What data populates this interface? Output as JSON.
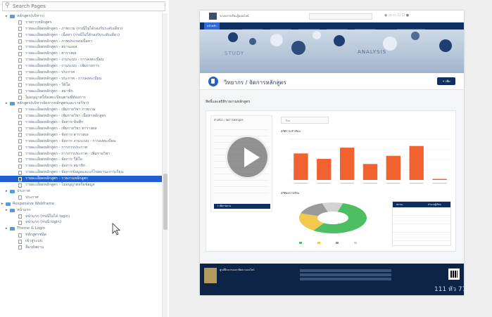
{
  "search": {
    "placeholder": "Search Pages"
  },
  "tree": [
    {
      "label": "หลักสูตร(บริหาร)",
      "level": 1,
      "type": "folder",
      "expanded": true
    },
    {
      "label": "รายการหลักสูตร",
      "level": 2,
      "type": "page"
    },
    {
      "label": "รายละเอียดหลักสูตร - ภาพรวม (กรณีไม่ได้รองรับระดับเดียว)",
      "level": 2,
      "type": "page"
    },
    {
      "label": "รายละเอียดหลักสูตร - เนื้อหา (กรณีไม่ได้รองรับระดับเดียว)",
      "level": 2,
      "type": "page"
    },
    {
      "label": "รายละเอียดหลักสูตร - ภาพประกอบเนื้อหา",
      "level": 2,
      "type": "page"
    },
    {
      "label": "รายละเอียดหลักสูตร - สถานะผล",
      "level": 2,
      "type": "page"
    },
    {
      "label": "รายละเอียดหลักสูตร - ตารางผล",
      "level": 2,
      "type": "page"
    },
    {
      "label": "รายละเอียดหลักสูตร - งานระบบ - การลงทะเบียน",
      "level": 2,
      "type": "page"
    },
    {
      "label": "รายละเอียดหลักสูตร - งานระบบ - เพิ่มรายการ",
      "level": 2,
      "type": "page"
    },
    {
      "label": "รายละเอียดหลักสูตร - ประกาศ",
      "level": 2,
      "type": "page"
    },
    {
      "label": "รายละเอียดหลักสูตร - ประกาศ - การลงทะเบียน",
      "level": 2,
      "type": "page"
    },
    {
      "label": "รายละเอียดหลักสูตร - วีดิโอ",
      "level": 2,
      "type": "page"
    },
    {
      "label": "รายละเอียดหลักสูตร - สมาชิก",
      "level": 2,
      "type": "page"
    },
    {
      "label": "ไม่อนุญาตให้ลงทะเบียนตามที่ต้องการ",
      "level": 2,
      "type": "page"
    },
    {
      "label": "หลักสูตร(บริหารจัดการหลักสูตรและรายวิชา)",
      "level": 1,
      "type": "folder",
      "expanded": true
    },
    {
      "label": "รายละเอียดหลักสูตร - เพิ่มรายวิชา ภาพรวม",
      "level": 2,
      "type": "page"
    },
    {
      "label": "รายละเอียดหลักสูตร - เพิ่มรายวิชา เนื้อหาหลักสูตร",
      "level": 2,
      "type": "page"
    },
    {
      "label": "รายละเอียดหลักสูตร - จัดการ บันทึก",
      "level": 2,
      "type": "page"
    },
    {
      "label": "รายละเอียดหลักสูตร - เพิ่มรายวิชา ตารางผล",
      "level": 2,
      "type": "page"
    },
    {
      "label": "รายละเอียดหลักสูตร - จัดการ ตารางผล",
      "level": 2,
      "type": "page"
    },
    {
      "label": "รายละเอียดหลักสูตร - จัดการ งานระบบ - การลงทะเบียน",
      "level": 2,
      "type": "page"
    },
    {
      "label": "รายละเอียดหลักสูตร - การการประกาศ",
      "level": 2,
      "type": "page"
    },
    {
      "label": "รายละเอียดหลักสูตร - การการประกาศ - เพิ่มรายวิชา",
      "level": 2,
      "type": "page"
    },
    {
      "label": "รายละเอียดหลักสูตร - จัดการ วีดิโอ",
      "level": 2,
      "type": "page"
    },
    {
      "label": "รายละเอียดหลักสูตร - จัดการ สมาชิก",
      "level": 2,
      "type": "page"
    },
    {
      "label": "รายละเอียดหลักสูตร - จัดการข้อมูลและแก้ไขสถานะการเรียน",
      "level": 2,
      "type": "page"
    },
    {
      "label": "รายละเอียดหลักสูตร - รายงานหลักสูตร",
      "level": 2,
      "type": "page",
      "selected": true
    },
    {
      "label": "รายละเอียดหลักสูตร - ไม่อนุญาตหรือข้อมูล",
      "level": 2,
      "type": "page"
    },
    {
      "label": "ประกาศ",
      "level": 1,
      "type": "folder",
      "expanded": true
    },
    {
      "label": "ประกาศ",
      "level": 2,
      "type": "page"
    },
    {
      "label": "Responsive Webframe",
      "level": 0,
      "type": "folder",
      "expanded": true
    },
    {
      "label": "หน้าแรก",
      "level": 1,
      "type": "folder",
      "expanded": true
    },
    {
      "label": "หน้าแรก (กรณีไม่ได้ login)",
      "level": 2,
      "type": "page"
    },
    {
      "label": "หน้าแรก (กรณี login)",
      "level": 2,
      "type": "page"
    },
    {
      "label": "Theme & Login",
      "level": 1,
      "type": "folder",
      "expanded": true
    },
    {
      "label": "หลักสูตรชนิด",
      "level": 2,
      "type": "page"
    },
    {
      "label": "เข้าสู่ระบบ",
      "level": 2,
      "type": "page"
    },
    {
      "label": "ลืมรหัสผ่าน",
      "level": 2,
      "type": "page"
    }
  ],
  "preview": {
    "site_name": "ระบบการเรียนรู้ออนไลน์",
    "nav_active": "หน้าหลัก",
    "banner_words": [
      "STUDY",
      "ANALYSIS"
    ],
    "page_title": "วิทยากร / จัดการหลักสูตร",
    "add_button": "+ เพิ่ม",
    "section_label": "สิทธิ์และสถิติรายงานหลักสูตร",
    "side_title": "ตัวเลือก / จัดการหลักสูตร",
    "side_button": "+ เพิ่มรายงาน",
    "filter_label": "ปีงบ",
    "chart1_title": "สถิติการเข้าเรียน",
    "chart2_title": "สถิติผลการเรียน",
    "table_headers": [
      "สถานะ",
      "จำนวนผู้เรียน"
    ],
    "footer_name": "ศูนย์ฝึกอบรมและพัฒนาออนไลน์",
    "footer_count": "111 หัว 77",
    "colors": {
      "nav": "#0f2f63",
      "accent": "#2e6bd8",
      "bar": "#f0622f",
      "footer": "#0e2447"
    }
  },
  "chart_data": [
    {
      "type": "bar",
      "categories": [
        "",
        "",
        "",
        "",
        "",
        "",
        ""
      ],
      "values": [
        78,
        62,
        95,
        47,
        71,
        100,
        3
      ],
      "ylim": [
        0,
        120
      ]
    },
    {
      "type": "pie",
      "slices": [
        {
          "color": "#4dbf62",
          "value": 55
        },
        {
          "color": "#f2c94c",
          "value": 20
        },
        {
          "color": "#9a9a9a",
          "value": 15
        },
        {
          "color": "#d3d3d3",
          "value": 10
        }
      ]
    }
  ],
  "video_overlay": {
    "icon": "play-icon"
  }
}
